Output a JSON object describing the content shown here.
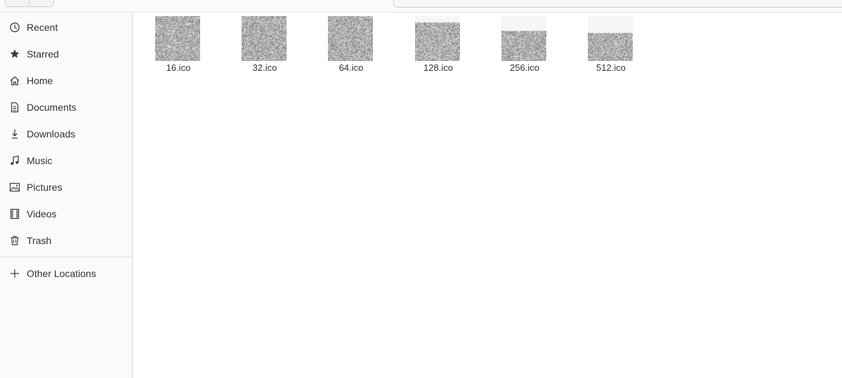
{
  "sidebar": {
    "items": [
      {
        "label": "Recent",
        "icon": "clock-icon"
      },
      {
        "label": "Starred",
        "icon": "star-icon"
      },
      {
        "label": "Home",
        "icon": "home-icon"
      },
      {
        "label": "Documents",
        "icon": "document-icon"
      },
      {
        "label": "Downloads",
        "icon": "download-icon"
      },
      {
        "label": "Music",
        "icon": "music-note-icon"
      },
      {
        "label": "Pictures",
        "icon": "image-icon"
      },
      {
        "label": "Videos",
        "icon": "film-icon"
      },
      {
        "label": "Trash",
        "icon": "trash-icon"
      }
    ],
    "other_locations": {
      "label": "Other Locations",
      "icon": "plus-icon"
    }
  },
  "files": [
    {
      "name": "16.ico"
    },
    {
      "name": "32.ico"
    },
    {
      "name": "64.ico"
    },
    {
      "name": "128.ico"
    },
    {
      "name": "256.ico"
    },
    {
      "name": "512.ico"
    }
  ]
}
